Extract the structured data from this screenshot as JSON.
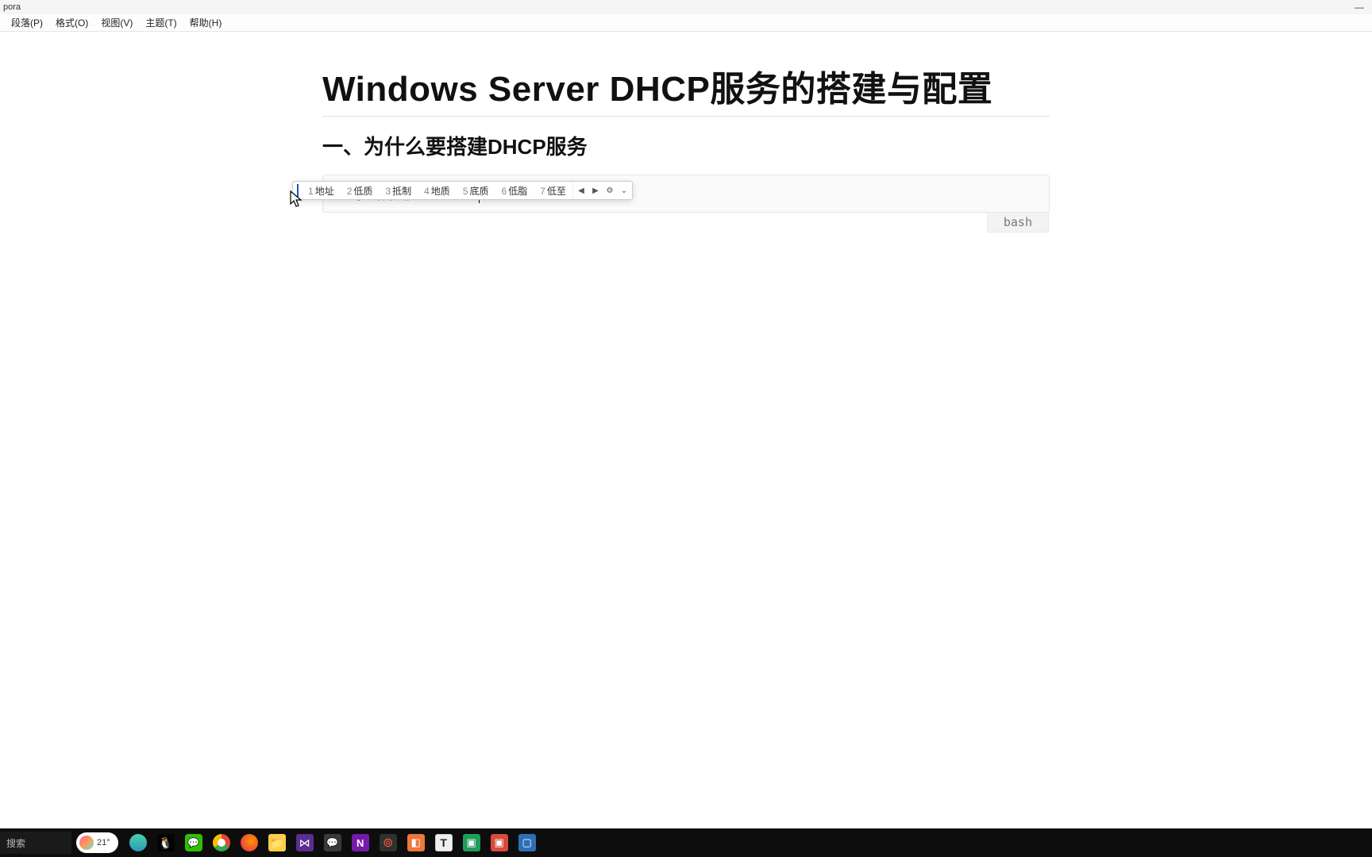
{
  "window": {
    "title": "pora",
    "minimize": "—"
  },
  "menu": {
    "paragraph": "段落(P)",
    "format": "格式(O)",
    "view": "视图(V)",
    "theme": "主题(T)",
    "help": "帮助(H)"
  },
  "document": {
    "h1": "Windows Server DHCP服务的搭建与配置",
    "h2": "一、为什么要搭建DHCP服务",
    "code_line_number": "1.",
    "code_prefix": "手动分配IPdi",
    "code_quote": "'zhi",
    "lang_tag": "bash"
  },
  "ime": {
    "candidates": [
      {
        "n": "1",
        "w": "地址"
      },
      {
        "n": "2",
        "w": "低质"
      },
      {
        "n": "3",
        "w": "抵制"
      },
      {
        "n": "4",
        "w": "地质"
      },
      {
        "n": "5",
        "w": "底质"
      },
      {
        "n": "6",
        "w": "低脂"
      },
      {
        "n": "7",
        "w": "低至"
      }
    ]
  },
  "taskbar": {
    "search": "搜索",
    "weather": "21°"
  }
}
